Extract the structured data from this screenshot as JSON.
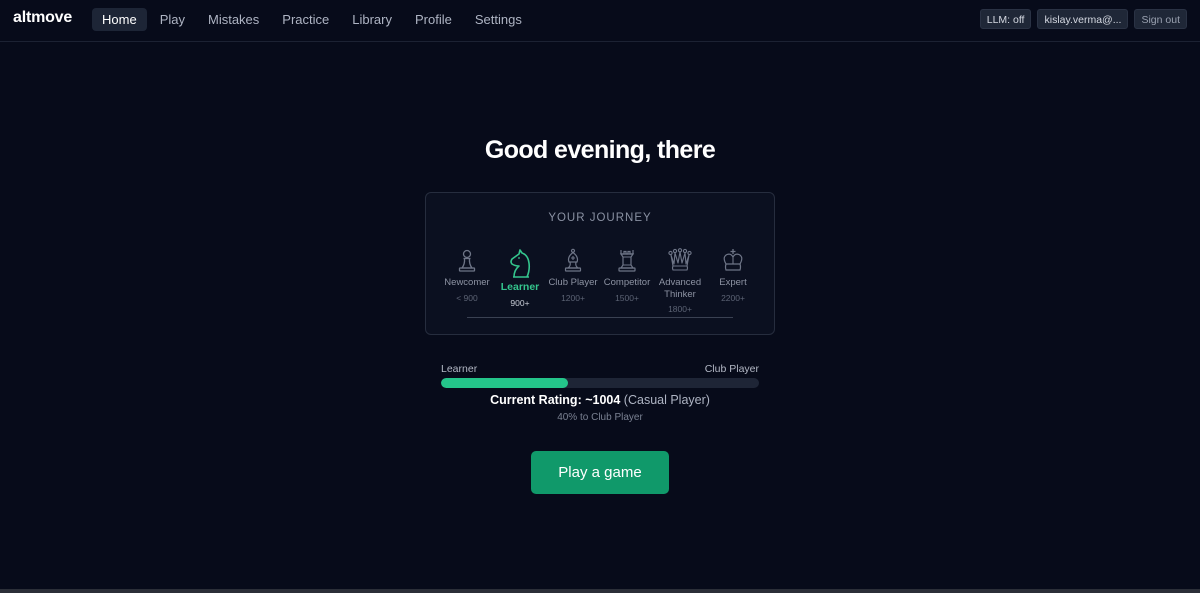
{
  "app": {
    "logo": "altmove"
  },
  "nav": {
    "items": [
      {
        "label": "Home",
        "active": true
      },
      {
        "label": "Play"
      },
      {
        "label": "Mistakes"
      },
      {
        "label": "Practice"
      },
      {
        "label": "Library"
      },
      {
        "label": "Profile"
      },
      {
        "label": "Settings"
      }
    ]
  },
  "header_right": {
    "llm_status": "LLM: off",
    "user": "kislay.verma@...",
    "sign_out": "Sign out"
  },
  "greeting": "Good evening, there",
  "journey": {
    "title": "YOUR JOURNEY",
    "stages": [
      {
        "name": "Newcomer",
        "rating": "< 900",
        "icon": "pawn-icon"
      },
      {
        "name": "Learner",
        "rating": "900+",
        "icon": "knight-icon",
        "current": true
      },
      {
        "name": "Club Player",
        "rating": "1200+",
        "icon": "bishop-icon"
      },
      {
        "name": "Competitor",
        "rating": "1500+",
        "icon": "rook-icon"
      },
      {
        "name": "Advanced Thinker",
        "rating": "1800+",
        "icon": "queen-icon"
      },
      {
        "name": "Expert",
        "rating": "2200+",
        "icon": "king-icon"
      }
    ]
  },
  "progress": {
    "from_label": "Learner",
    "to_label": "Club Player",
    "fraction": 0.4,
    "rating_prefix": "Current Rating: ~1004",
    "rating_tier": "(Casual Player)",
    "note": "40% to Club Player"
  },
  "cta": {
    "label": "Play a game"
  },
  "colors": {
    "accent": "#24c58a",
    "button": "#10996a",
    "background": "#070b1a"
  }
}
